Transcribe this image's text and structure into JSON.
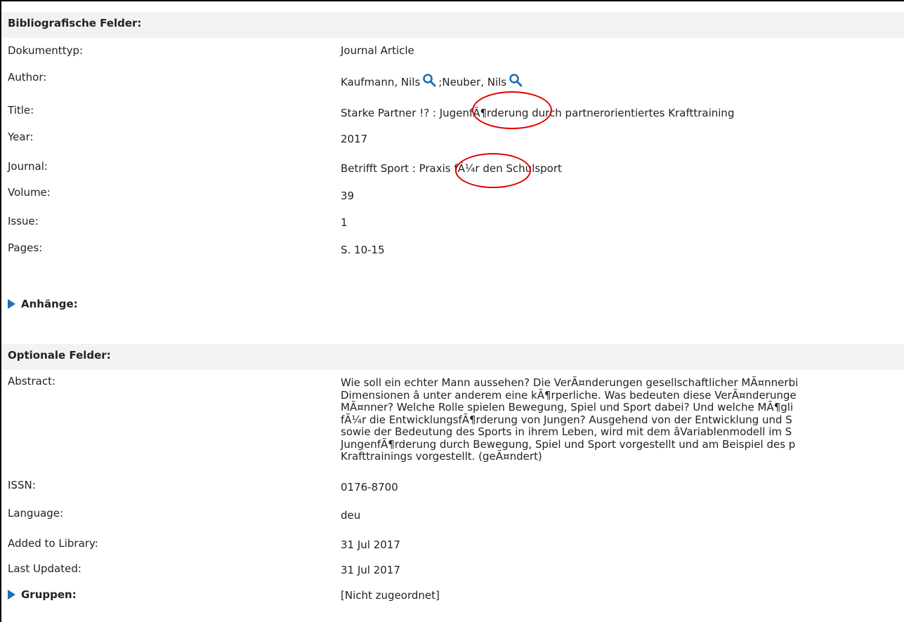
{
  "sections": {
    "bibliographic": "Bibliografische Felder:",
    "attachments": "Anhänge:",
    "optional": "Optionale Felder:"
  },
  "fields": {
    "doctype": {
      "label": "Dokumenttyp:",
      "value": "Journal Article"
    },
    "author": {
      "label": "Author:",
      "author1": "Kaufmann, Nils",
      "separator": ";",
      "author2": "Neuber, Nils"
    },
    "title": {
      "label": "Title:",
      "value": "Starke Partner !? : JugenfÃ¶rderung durch partnerorientiertes Krafttraining"
    },
    "year": {
      "label": "Year:",
      "value": "2017"
    },
    "journal": {
      "label": "Journal:",
      "value": "Betrifft Sport : Praxis fÃ¼r den Schulsport"
    },
    "volume": {
      "label": "Volume:",
      "value": "39"
    },
    "issue": {
      "label": "Issue:",
      "value": "1"
    },
    "pages": {
      "label": "Pages:",
      "value": "S. 10-15"
    },
    "abstract": {
      "label": "Abstract:",
      "lines": [
        "Wie soll ein echter Mann aussehen? Die VerÃ¤nderungen gesellschaftlicher MÃ¤nnerbi",
        "Dimensionen â unter anderem eine kÃ¶rperliche. Was bedeuten diese VerÃ¤nderunge",
        "MÃ¤nner? Welche Rolle spielen Bewegung, Spiel und Sport dabei? Und welche MÃ¶gli",
        "fÃ¼r die EntwicklungsfÃ¶rderung von Jungen? Ausgehend von der Entwicklung und S",
        "sowie der Bedeutung des Sports in ihrem Leben, wird mit dem âVariablenmodell im S",
        "JungenfÃ¶rderung durch Bewegung, Spiel und Sport vorgestellt und am Beispiel des p",
        "Krafttrainings vorgestellt. (geÃ¤ndert)"
      ]
    },
    "issn": {
      "label": "ISSN:",
      "value": "0176-8700"
    },
    "language": {
      "label": "Language:",
      "value": "deu"
    },
    "added": {
      "label": "Added to Library:",
      "value": "31 Jul 2017"
    },
    "updated": {
      "label": "Last Updated:",
      "value": "31 Jul 2017"
    },
    "groups": {
      "label": "Gruppen:",
      "value": "[Nicht zugeordnet]"
    }
  },
  "icons": {
    "search": "search-icon",
    "expand": "triangle-right-icon"
  },
  "colors": {
    "accent": "#1c6fb6",
    "annotation": "#e00000",
    "section_bg": "#f2f2f2"
  }
}
